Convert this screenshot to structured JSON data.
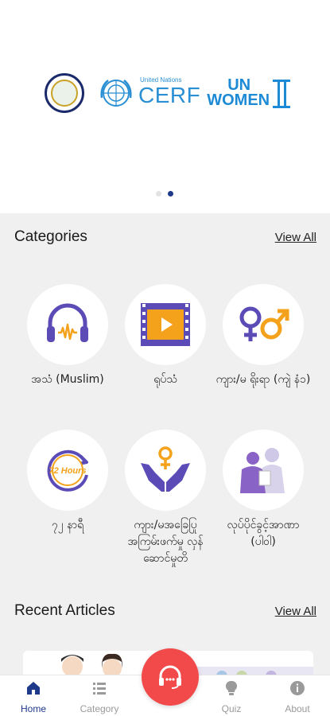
{
  "banner": {
    "logos": [
      "seal-logo",
      "un-emblem",
      "cerf-logo",
      "un-women-logo"
    ],
    "cerf_small": "United Nations",
    "cerf_big": "CERF",
    "unwomen_top": "UN",
    "unwomen_bottom": "WOMEN",
    "carousel": {
      "count": 2,
      "active_index": 1
    }
  },
  "categories": {
    "title": "Categories",
    "view_all": "View All",
    "items": [
      {
        "label": "အသံ (Muslim)",
        "icon": "headphones-icon"
      },
      {
        "label": "ရုပ်သံ",
        "icon": "video-film-icon"
      },
      {
        "label": "ကျား/မ ရိုးရာ (ကျဲ နံ၁)",
        "icon": "gender-symbols-icon"
      },
      {
        "label": "၇၂ နာရီ",
        "icon": "72-hours-icon"
      },
      {
        "label": "ကျား/မအခြေပြု အကြမ်းဖက်မှု လှန်ဆောင်မှုတိ",
        "icon": "hands-female-symbol-icon"
      },
      {
        "label": "လုပ်ပိုင်ခွင့်အာဏာ (ပါဝါ)",
        "icon": "power-people-icon"
      }
    ]
  },
  "recent": {
    "title": "Recent Articles",
    "view_all": "View All"
  },
  "bottom_nav": {
    "items": [
      {
        "label": "Home",
        "icon": "home-icon",
        "active": true
      },
      {
        "label": "Category",
        "icon": "list-icon",
        "active": false
      },
      {
        "label": "Quiz",
        "icon": "lightbulb-icon",
        "active": false
      },
      {
        "label": "About",
        "icon": "info-icon",
        "active": false
      }
    ],
    "fab_icon": "headset-icon"
  },
  "colors": {
    "accent": "#1f3a8a",
    "fab": "#f24a4a",
    "purple": "#5b4bb7",
    "orange": "#f4a21b"
  }
}
